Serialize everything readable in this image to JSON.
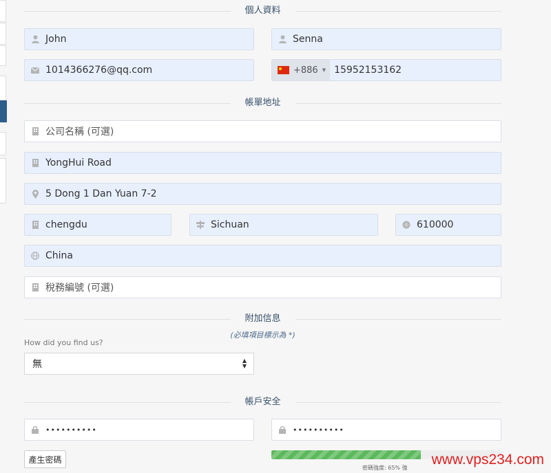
{
  "sections": {
    "personal": "個人資料",
    "billing": "帳單地址",
    "additional": "附加信息",
    "security": "帳戶安全"
  },
  "personal": {
    "first_name": "John",
    "last_name": "Senna",
    "email": "1014366276@qq.com",
    "dial_code": "+886",
    "phone": "15952153162"
  },
  "billing": {
    "company_placeholder": "公司名稱 (可選)",
    "address1": "YongHui Road",
    "address2": "5 Dong 1 Dan Yuan 7-2",
    "city": "chengdu",
    "state": "Sichuan",
    "postcode": "610000",
    "country": "China",
    "tax_placeholder": "稅務編號 (可選)"
  },
  "additional": {
    "required_hint": "(必填項目標示為 *)",
    "question": "How did you find us?",
    "selected": "無"
  },
  "security": {
    "password_mask": "••••••••••",
    "confirm_mask": "••••••••••",
    "generate_button": "產生密碼",
    "strength_percent": 65,
    "strength_label": "密碼強度: 65% 強"
  },
  "watermark": "www.vps234.com",
  "colors": {
    "input_fill": "#e8f0fe",
    "section_text": "#38506b",
    "strength_bar": "#5cb85c",
    "watermark": "#e01f1f"
  }
}
